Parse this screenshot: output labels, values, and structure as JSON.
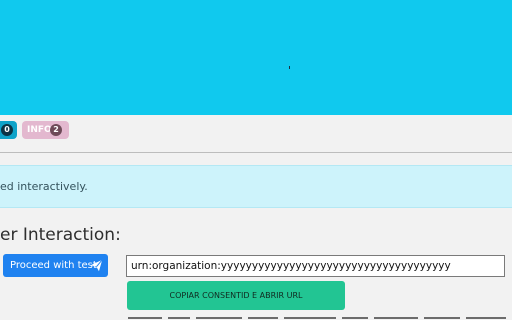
{
  "banner": {
    "color": "#10c9ee"
  },
  "badges": {
    "first": {
      "count": "0",
      "color": "#0fa3c9"
    },
    "info": {
      "label": "INFO",
      "count": "2",
      "color": "#e3b8cf"
    }
  },
  "alert": {
    "text": "ed interactively."
  },
  "section": {
    "title": "er Interaction:"
  },
  "buttons": {
    "proceed_label": "Proceed with test",
    "proceed_icon": "paper-plane-icon",
    "copy_label": "COPIAR CONSENTID E ABRIR URL"
  },
  "urn_field": {
    "value": "urn:organization:yyyyyyyyyyyyyyyyyyyyyyyyyyyyyyyyyyyyy"
  },
  "colors": {
    "primary": "#1f82f0",
    "success": "#22c593",
    "info_alert": "#cdf3fb"
  }
}
